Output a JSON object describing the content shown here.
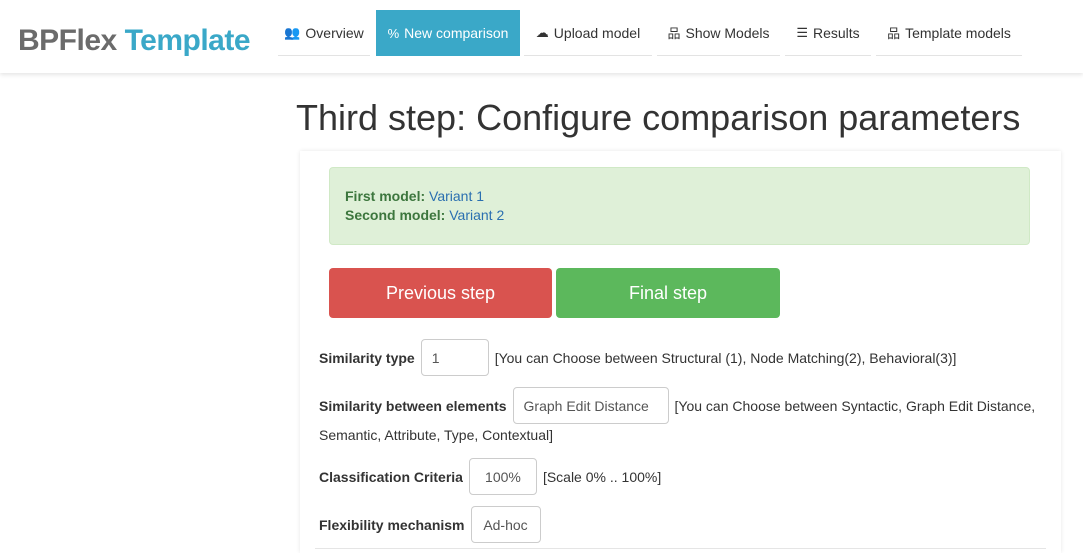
{
  "brand": {
    "part1": "BPFlex",
    "part2": "Template"
  },
  "nav": {
    "items": [
      {
        "icon": "users-icon",
        "glyph": "👥",
        "label": "Overview"
      },
      {
        "icon": "percent-icon",
        "glyph": "%",
        "label": "New comparison"
      },
      {
        "icon": "cloud-upload-icon",
        "glyph": "☁",
        "label": "Upload model"
      },
      {
        "icon": "sitemap-icon",
        "glyph": "品",
        "label": "Show Models"
      },
      {
        "icon": "list-icon",
        "glyph": "☰",
        "label": "Results"
      },
      {
        "icon": "sitemap-icon",
        "glyph": "品",
        "label": "Template models"
      }
    ],
    "active_index": 1
  },
  "page": {
    "title": "Third step: Configure comparison parameters"
  },
  "alert": {
    "first_label": "First model:",
    "first_value": "Variant 1",
    "second_label": "Second model:",
    "second_value": "Variant 2"
  },
  "buttons": {
    "previous": "Previous step",
    "final": "Final step"
  },
  "form": {
    "similarity_type": {
      "label": "Similarity type",
      "value": "1",
      "hint": "[You can Choose between Structural (1), Node Matching(2), Behavioral(3)]"
    },
    "similarity_elements": {
      "label": "Similarity between elements",
      "value": "Graph Edit Distance",
      "hint": "[You can Choose between Syntactic, Graph Edit Distance,",
      "hint_cont": "Semantic, Attribute, Type, Contextual]"
    },
    "classification": {
      "label": "Classification Criteria",
      "value": "100%",
      "hint": "[Scale 0% .. 100%]"
    },
    "flexibility": {
      "label": "Flexibility mechanism",
      "value": "Ad-hoc"
    }
  },
  "colors": {
    "brand_gray": "#6b6b6b",
    "brand_blue": "#3aa8c8",
    "nav_active": "#3aa8c8",
    "alert_bg": "#dff0d8",
    "alert_label": "#3c763d",
    "alert_link": "#2a6fb0",
    "btn_danger": "#d9534f",
    "btn_success": "#5cb85c"
  }
}
